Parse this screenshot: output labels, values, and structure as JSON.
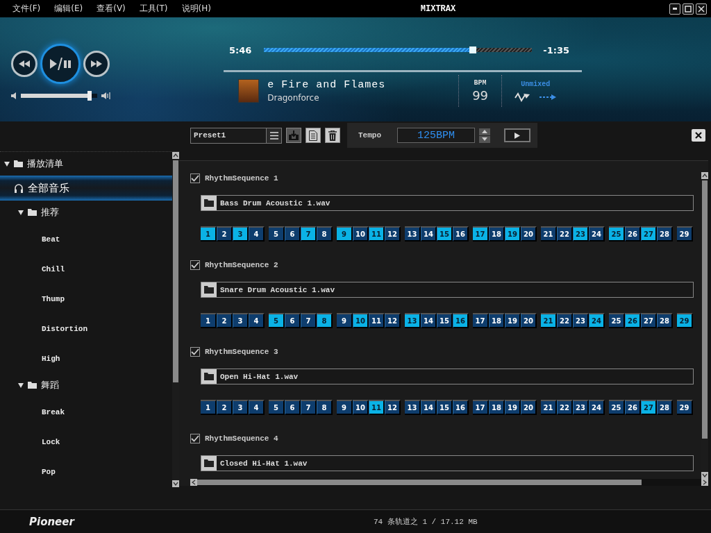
{
  "window": {
    "title": "MIXTRAX"
  },
  "menu": [
    "文件(F)",
    "编辑(E)",
    "查看(V)",
    "工具(T)",
    "说明(H)"
  ],
  "player": {
    "elapsed": "5:46",
    "remaining": "-1:35",
    "progress": {
      "level": 0.78
    },
    "volume": {
      "level": 0.9
    },
    "track": {
      "title": "e Fire and Flames",
      "artist": "Dragonforce"
    },
    "bpm": {
      "label": "BPM",
      "value": "99"
    },
    "mix": {
      "label": "Unmixed"
    }
  },
  "sidebar": {
    "items": [
      {
        "kind": "folder",
        "label": "播放清单",
        "expanded": true,
        "selected": false,
        "children": [
          {
            "kind": "all",
            "label": "全部音乐",
            "selected": true
          },
          {
            "kind": "folder",
            "label": "推荐",
            "expanded": true,
            "selected": false,
            "children": [
              {
                "kind": "leaf",
                "label": "Beat",
                "selected": false
              },
              {
                "kind": "leaf",
                "label": "Chill",
                "selected": false
              },
              {
                "kind": "leaf",
                "label": "Thump",
                "selected": false
              },
              {
                "kind": "leaf",
                "label": "Distortion",
                "selected": false
              },
              {
                "kind": "leaf",
                "label": "High",
                "selected": false
              }
            ]
          },
          {
            "kind": "folder",
            "label": "舞蹈",
            "expanded": true,
            "selected": false,
            "children": [
              {
                "kind": "leaf",
                "label": "Break",
                "selected": false
              },
              {
                "kind": "leaf",
                "label": "Lock",
                "selected": false
              },
              {
                "kind": "leaf",
                "label": "Pop",
                "selected": false
              }
            ]
          }
        ]
      }
    ]
  },
  "toolbar": {
    "preset": "Preset1",
    "tempo_label": "Tempo",
    "tempo_value": "125BPM"
  },
  "sequences": [
    {
      "name": "RhythmSequence 1",
      "checked": true,
      "file": "Bass Drum Acoustic 1.wav",
      "steps": [
        {
          "label": "1",
          "on": true
        },
        {
          "label": "2",
          "on": false
        },
        {
          "label": "3",
          "on": true
        },
        {
          "label": "4",
          "on": false
        },
        {
          "label": "5",
          "on": false
        },
        {
          "label": "6",
          "on": false
        },
        {
          "label": "7",
          "on": true
        },
        {
          "label": "8",
          "on": false
        },
        {
          "label": "9",
          "on": true
        },
        {
          "label": "10",
          "on": false
        },
        {
          "label": "11",
          "on": true
        },
        {
          "label": "12",
          "on": false
        },
        {
          "label": "13",
          "on": false
        },
        {
          "label": "14",
          "on": false
        },
        {
          "label": "15",
          "on": true
        },
        {
          "label": "16",
          "on": false
        },
        {
          "label": "17",
          "on": true
        },
        {
          "label": "18",
          "on": false
        },
        {
          "label": "19",
          "on": true
        },
        {
          "label": "20",
          "on": false
        },
        {
          "label": "21",
          "on": false
        },
        {
          "label": "22",
          "on": false
        },
        {
          "label": "23",
          "on": true
        },
        {
          "label": "24",
          "on": false
        },
        {
          "label": "25",
          "on": true
        },
        {
          "label": "26",
          "on": false
        },
        {
          "label": "27",
          "on": true
        },
        {
          "label": "28",
          "on": false
        },
        {
          "label": "29",
          "on": false
        }
      ]
    },
    {
      "name": "RhythmSequence 2",
      "checked": true,
      "file": "Snare Drum Acoustic 1.wav",
      "steps": [
        {
          "label": "1",
          "on": false
        },
        {
          "label": "2",
          "on": false
        },
        {
          "label": "3",
          "on": false
        },
        {
          "label": "4",
          "on": false
        },
        {
          "label": "5",
          "on": true
        },
        {
          "label": "6",
          "on": false
        },
        {
          "label": "7",
          "on": false
        },
        {
          "label": "8",
          "on": true
        },
        {
          "label": "9",
          "on": false
        },
        {
          "label": "10",
          "on": true
        },
        {
          "label": "11",
          "on": false
        },
        {
          "label": "12",
          "on": false
        },
        {
          "label": "13",
          "on": true
        },
        {
          "label": "14",
          "on": false
        },
        {
          "label": "15",
          "on": false
        },
        {
          "label": "16",
          "on": true
        },
        {
          "label": "17",
          "on": false
        },
        {
          "label": "18",
          "on": false
        },
        {
          "label": "19",
          "on": false
        },
        {
          "label": "20",
          "on": false
        },
        {
          "label": "21",
          "on": true
        },
        {
          "label": "22",
          "on": false
        },
        {
          "label": "23",
          "on": false
        },
        {
          "label": "24",
          "on": true
        },
        {
          "label": "25",
          "on": false
        },
        {
          "label": "26",
          "on": true
        },
        {
          "label": "27",
          "on": false
        },
        {
          "label": "28",
          "on": false
        },
        {
          "label": "29",
          "on": true
        }
      ]
    },
    {
      "name": "RhythmSequence 3",
      "checked": true,
      "file": "Open Hi-Hat 1.wav",
      "steps": [
        {
          "label": "1",
          "on": false
        },
        {
          "label": "2",
          "on": false
        },
        {
          "label": "3",
          "on": false
        },
        {
          "label": "4",
          "on": false
        },
        {
          "label": "5",
          "on": false
        },
        {
          "label": "6",
          "on": false
        },
        {
          "label": "7",
          "on": false
        },
        {
          "label": "8",
          "on": false
        },
        {
          "label": "9",
          "on": false
        },
        {
          "label": "10",
          "on": false
        },
        {
          "label": "11",
          "on": true
        },
        {
          "label": "12",
          "on": false
        },
        {
          "label": "13",
          "on": false
        },
        {
          "label": "14",
          "on": false
        },
        {
          "label": "15",
          "on": false
        },
        {
          "label": "16",
          "on": false
        },
        {
          "label": "17",
          "on": false
        },
        {
          "label": "18",
          "on": false
        },
        {
          "label": "19",
          "on": false
        },
        {
          "label": "20",
          "on": false
        },
        {
          "label": "21",
          "on": false
        },
        {
          "label": "22",
          "on": false
        },
        {
          "label": "23",
          "on": false
        },
        {
          "label": "24",
          "on": false
        },
        {
          "label": "25",
          "on": false
        },
        {
          "label": "26",
          "on": false
        },
        {
          "label": "27",
          "on": true
        },
        {
          "label": "28",
          "on": false
        },
        {
          "label": "29",
          "on": false
        }
      ]
    },
    {
      "name": "RhythmSequence 4",
      "checked": true,
      "file": "Closed Hi-Hat 1.wav"
    }
  ],
  "footer": {
    "brand": "Pioneer"
  },
  "status_bar": "74 条轨道之 1 / 17.12 MB"
}
